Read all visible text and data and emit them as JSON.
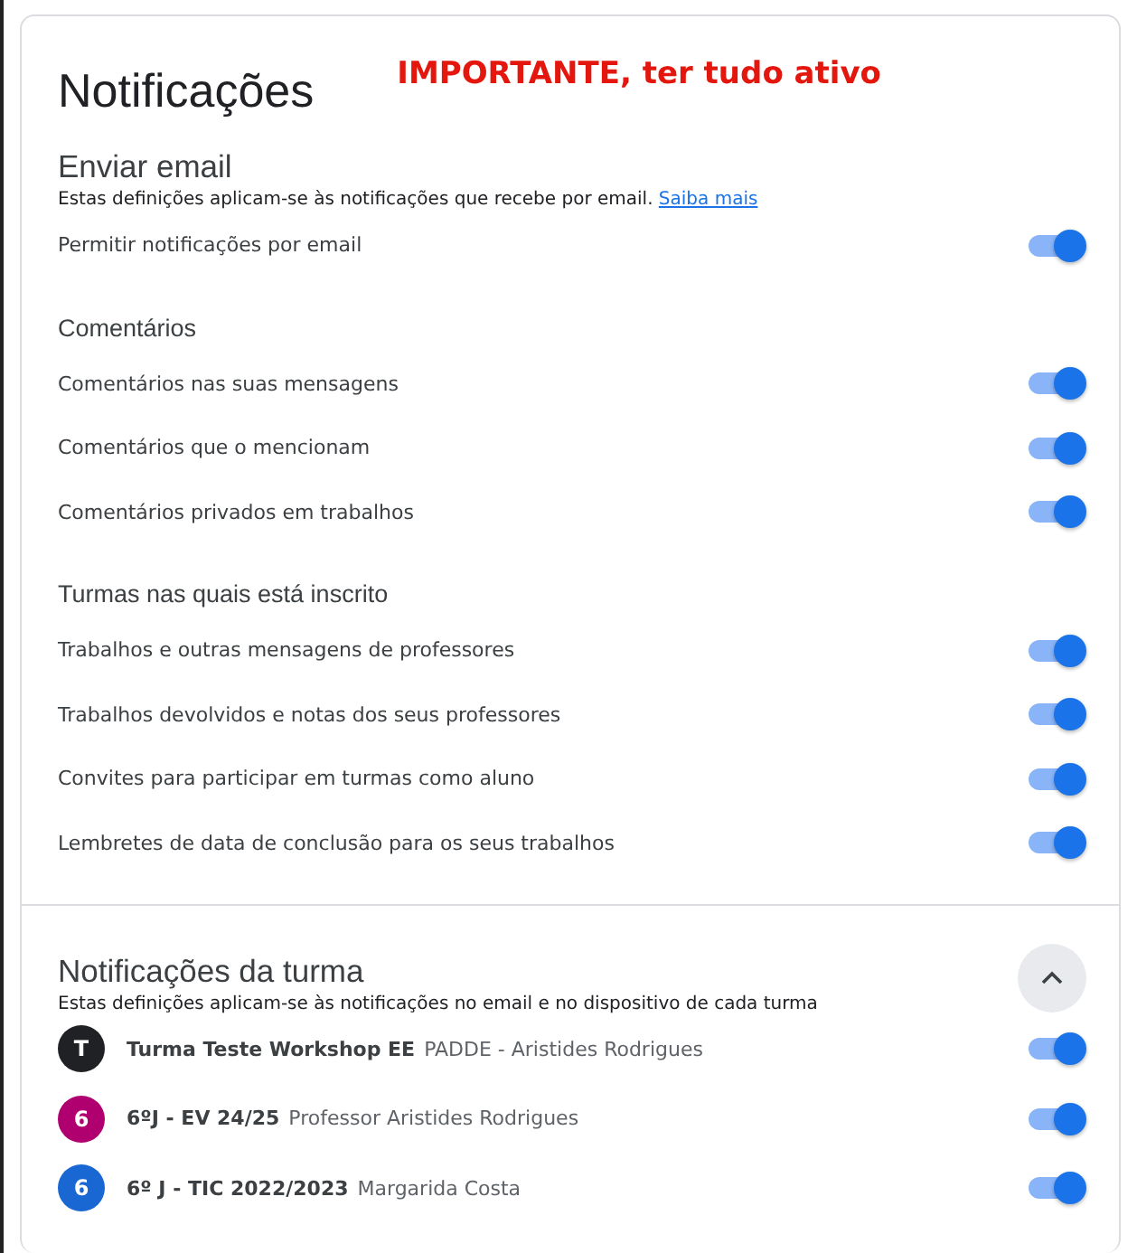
{
  "title": "Notificações",
  "annotation": "IMPORTANTE, ter tudo ativo",
  "email_section": {
    "heading": "Enviar email",
    "description": "Estas definições aplicam-se às notificações que recebe por email.",
    "link": "Saiba mais",
    "rows": [
      {
        "kind": "toggle",
        "label": "Permitir notificações por email",
        "on": true
      },
      {
        "kind": "subheading",
        "label": "Comentários"
      },
      {
        "kind": "toggle",
        "label": "Comentários nas suas mensagens",
        "on": true
      },
      {
        "kind": "toggle",
        "label": "Comentários que o mencionam",
        "on": true
      },
      {
        "kind": "toggle",
        "label": "Comentários privados em trabalhos",
        "on": true
      },
      {
        "kind": "subheading",
        "label": "Turmas nas quais está inscrito"
      },
      {
        "kind": "toggle",
        "label": "Trabalhos e outras mensagens de professores",
        "on": true
      },
      {
        "kind": "toggle",
        "label": "Trabalhos devolvidos e notas dos seus professores",
        "on": true
      },
      {
        "kind": "toggle",
        "label": "Convites para participar em turmas como aluno",
        "on": true
      },
      {
        "kind": "toggle",
        "label": "Lembretes de data de conclusão para os seus trabalhos",
        "on": true
      }
    ]
  },
  "class_section": {
    "heading": "Notificações da turma",
    "description": "Estas definições aplicam-se às notificações no email e no dispositivo de cada turma",
    "expanded": true,
    "classes": [
      {
        "initial": "T",
        "color": "#202124",
        "name": "Turma Teste Workshop EE",
        "teacher": "PADDE - Aristides Rodrigues",
        "on": true
      },
      {
        "initial": "6",
        "color": "#b0006f",
        "name": "6ºJ - EV 24/25",
        "teacher": "Professor Aristides Rodrigues",
        "on": true
      },
      {
        "initial": "6",
        "color": "#1967d2",
        "name": "6º J - TIC 2022/2023",
        "teacher": "Margarida Costa",
        "on": true
      }
    ]
  }
}
